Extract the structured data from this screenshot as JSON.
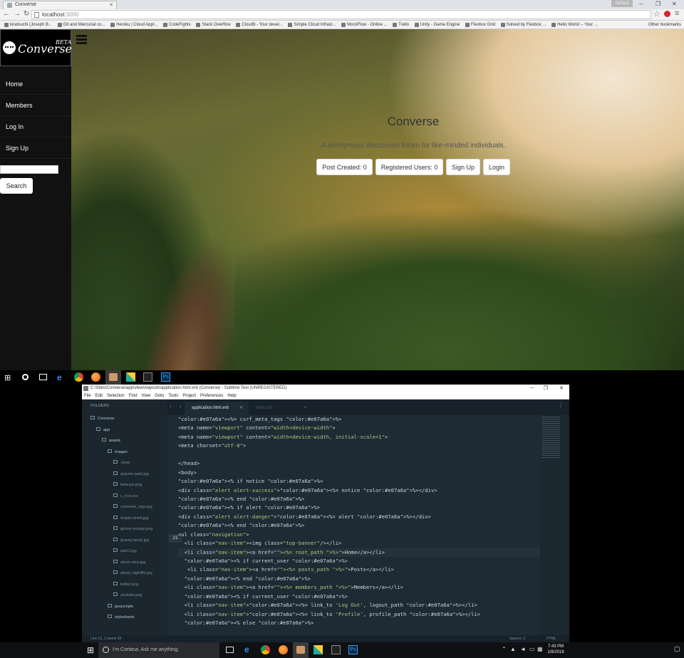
{
  "browser": {
    "tab_title": "Converse",
    "user_chip": "Default",
    "url_host": "localhost",
    "url_port": ":3000",
    "bookmarks": [
      "kiratsuchi (Joseph B...",
      "Git and Mercurial co...",
      "Heroku | Cloud Appl...",
      "CodeFights",
      "Stack Overflow",
      "Cloud9 - Your devel...",
      "Simple Cloud Infrast...",
      "MockFlow - Online ...",
      "Trello",
      "Unity - Game Engine",
      "Flexbox Grid",
      "Solved by Flexbox ...",
      "Hello World -- Your ..."
    ],
    "other_bookmarks": "Other bookmarks"
  },
  "site": {
    "brand_word": "Converse",
    "brand_tag": "BETA",
    "nav": [
      "Home",
      "Members",
      "Log In",
      "Sign Up"
    ],
    "search_button": "Search",
    "hero_title": "Converse",
    "hero_subtitle": "A anonymous disccusion forum for like-minded individuals.",
    "posts_created": "Post Created: 0",
    "registered_users": "Registered Users: 0",
    "signup_button": "Sign Up",
    "login_button": "Login"
  },
  "editor": {
    "title": "C:\\Sites\\Converse\\app\\views\\layouts\\application.html.erb (Converse) - Sublime Text (UNREGISTERED)",
    "menu": [
      "File",
      "Edit",
      "Selection",
      "Find",
      "View",
      "Goto",
      "Tools",
      "Project",
      "Preferences",
      "Help"
    ],
    "folders_header": "FOLDERS",
    "tree": [
      "Converse",
      "app",
      "assets",
      "images",
      ".keep",
      "autumn-park.jpg",
      "beta-pic.png",
      "c_icon.ico",
      "converse_logo.jpg",
      "empty-street.jpg",
      "glossy-orange.png",
      "grassy-lands.jpg",
      "park1.jpg",
      "street-view.jpg",
      "street_nightlife.jpg",
      "twitter.png",
      "youtube.png",
      "javascripts",
      "stylesheets"
    ],
    "active_tab": "application.html.erb",
    "other_tab": "main.css",
    "line_numbers": [
      "",
      "",
      "",
      "",
      "",
      "",
      "",
      "",
      "",
      "",
      "",
      "",
      "",
      "",
      "",
      "",
      "",
      "",
      "",
      "",
      "",
      "",
      ""
    ],
    "current_line": "21",
    "code_lines": [
      "<%= csrf_meta_tags %>",
      "<meta name=\"viewport\" content=\"width=device-width\">",
      "<meta name=\"viewport\" content=\"width=device-width, initial-scale=1\">",
      "<meta charset=\"utf-8\">",
      "",
      "</head>",
      "<body>",
      "<% if notice %>",
      "<div class=\"alert alert-success\"><%= notice %></div>",
      "<% end %>",
      "<% if alert %>",
      "<div class=\"alert alert-danger\"><%= alert %></div>",
      "<% end %>",
      "<ul class=\"navigation\">",
      "  <li class=\"nav-item\"><img class=\"top-banner\"/></li>",
      "  <li class=\"nav-item\"><a href=\"<%= root_path %>\">Home</a></li>",
      "  <% if current_user %>",
      "   <li class=\"nav-item\"><a href=\"<%= posts_path %>\">Posts</a></li>",
      "  <% end %>",
      "  <li class=\"nav-item\"><a href=\"<%= members_path %>\">Members</a></li>",
      "  <% if current_user %>",
      "  <li class=\"nav-item\"><%= link_to 'Log Out', logout_path %></li>",
      "  <li class=\"nav-item\"><%= link_to 'Profile', profile_path %></li>",
      "  <% else %>"
    ],
    "status_left": "Line 21, Column 50",
    "status_spaces": "Spaces: 2",
    "status_syntax": "HTML"
  },
  "taskbar": {
    "cortana": "I'm Cortana. Ask me anything.",
    "time": "7:43 PM",
    "date": "1/8/2016"
  },
  "colors": {
    "sidebar": "#111111",
    "editor_bg": "#1f2b34",
    "keyword": "#e07a6a",
    "string": "#a8c97f",
    "tag": "#cdd3de"
  }
}
